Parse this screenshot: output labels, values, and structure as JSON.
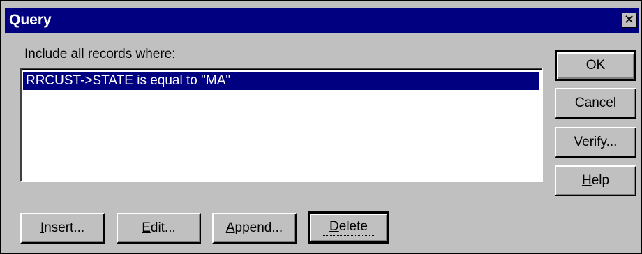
{
  "window": {
    "title": "Query",
    "close_glyph": "✕"
  },
  "query": {
    "label": "Include all records where:",
    "conditions": [
      "RRCUST->STATE is equal to \"MA\""
    ]
  },
  "side_buttons": {
    "ok": "OK",
    "cancel": "Cancel",
    "verify": {
      "accel": "V",
      "rest": "erify..."
    },
    "help": {
      "accel": "H",
      "rest": "elp"
    }
  },
  "bottom_buttons": {
    "insert": {
      "accel": "I",
      "rest": "nsert..."
    },
    "edit": {
      "accel": "E",
      "rest": "dit..."
    },
    "append": {
      "accel": "A",
      "rest": "ppend..."
    },
    "delete": {
      "accel": "D",
      "rest": "elete"
    }
  },
  "colors": {
    "face": "#c0c0c0",
    "titlebar": "#000080",
    "selection": "#000080"
  }
}
